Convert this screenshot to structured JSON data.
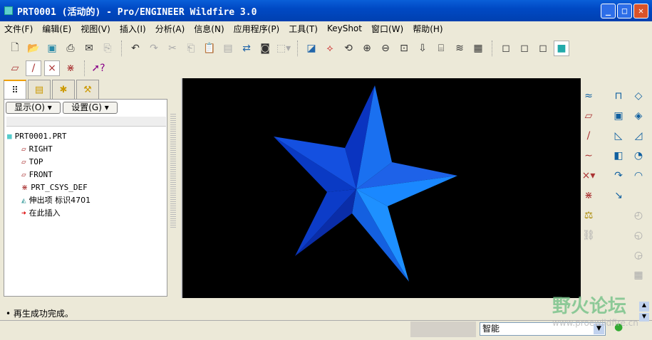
{
  "window": {
    "title": "PRT0001 (活动的) - Pro/ENGINEER Wildfire 3.0"
  },
  "menu": [
    "文件(F)",
    "编辑(E)",
    "视图(V)",
    "插入(I)",
    "分析(A)",
    "信息(N)",
    "应用程序(P)",
    "工具(T)",
    "KeyShot",
    "窗口(W)",
    "帮助(H)"
  ],
  "panel": {
    "show_label": "显示(O) ▾",
    "settings_label": "设置(G) ▾"
  },
  "tree": {
    "root": "PRT0001.PRT",
    "items": [
      "RIGHT",
      "TOP",
      "FRONT",
      "PRT_CSYS_DEF",
      "伸出项 标识4701",
      "在此插入"
    ]
  },
  "status": {
    "message": "• 再生成功完成。",
    "filter": "智能"
  },
  "watermark": {
    "text": "野火论坛",
    "url": "www.proewildfire.cn"
  },
  "colors": {
    "title": "#0a5fd8",
    "viewport": "#000000",
    "star_light": "#1e8cff",
    "star_dark": "#0a2fb0"
  }
}
